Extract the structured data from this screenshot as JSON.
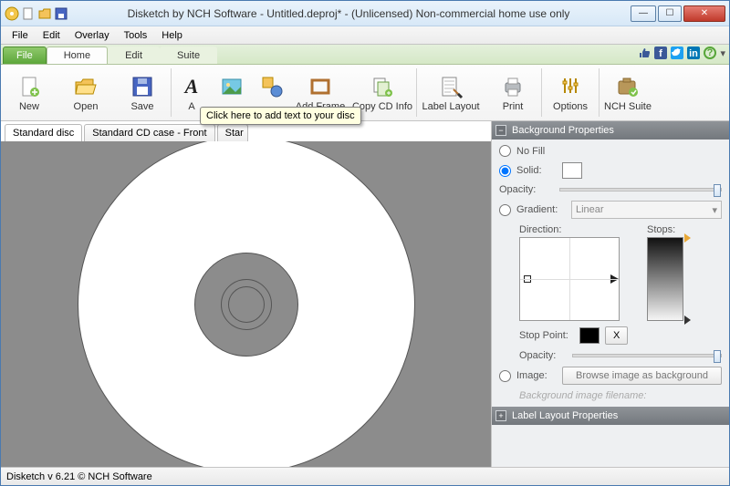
{
  "window": {
    "title": "Disketch by NCH Software - Untitled.deproj* - (Unlicensed) Non-commercial home use only"
  },
  "menubar": {
    "items": [
      "File",
      "Edit",
      "Overlay",
      "Tools",
      "Help"
    ]
  },
  "ribbon": {
    "tabs": {
      "file": "File",
      "home": "Home",
      "edit": "Edit",
      "suite": "Suite"
    },
    "buttons": {
      "new": "New",
      "open": "Open",
      "save": "Save",
      "addtext": "A",
      "addimage": "",
      "addshape": "",
      "addframe": "Add Frame",
      "copycd": "Copy CD Info",
      "labellayout": "Label Layout",
      "print": "Print",
      "options": "Options",
      "nchsuite": "NCH Suite"
    },
    "tooltip": "Click here to add text to your disc"
  },
  "doc_tabs": [
    "Standard disc",
    "Standard CD case - Front",
    "Star"
  ],
  "panel": {
    "bg_header": "Background Properties",
    "nofill": "No Fill",
    "solid": "Solid:",
    "opacity": "Opacity:",
    "gradient": "Gradient:",
    "gradient_type": "Linear",
    "direction": "Direction:",
    "stops": "Stops:",
    "stop_point": "Stop Point:",
    "x_btn": "X",
    "image": "Image:",
    "browse": "Browse image as background",
    "bg_filename": "Background image filename:",
    "label_layout_header": "Label Layout Properties"
  },
  "status": "Disketch v 6.21 © NCH Software"
}
